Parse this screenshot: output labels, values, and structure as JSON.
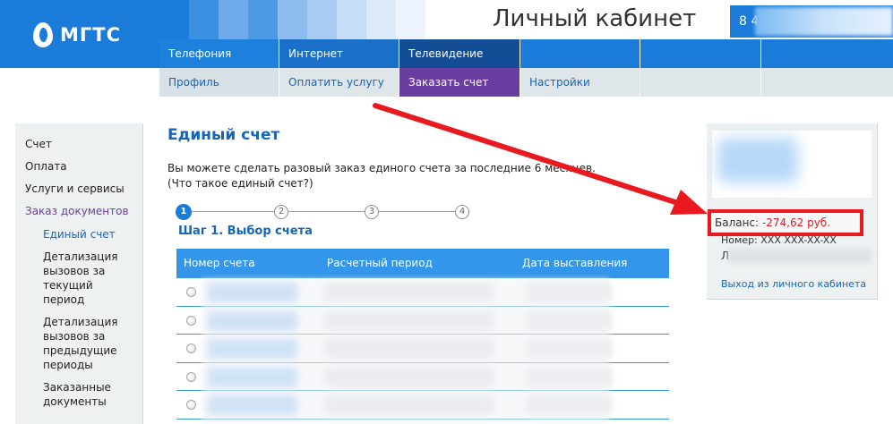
{
  "brand": {
    "logo_text": "МГТС",
    "cabinet_title": "Личный кабинет",
    "phone_prefix": "8 4"
  },
  "main_nav": {
    "items": [
      "Телефония",
      "Интернет",
      "Телевидение"
    ]
  },
  "sub_nav": {
    "items": [
      "Профиль",
      "Оплатить услугу",
      "Заказать счет",
      "Настройки"
    ],
    "active": "Заказать счет"
  },
  "sidebar": {
    "items": [
      "Счет",
      "Оплата",
      "Услуги и сервисы",
      "Заказ документов"
    ],
    "active_item": "Заказ документов",
    "sub_items": [
      "Единый счет",
      "Детализация вызовов за текущий период",
      "Детализация вызовов за предыдущие периоды",
      "Заказанные документы"
    ],
    "active_sub": "Единый счет"
  },
  "main": {
    "title": "Единый счет",
    "intro_line1": "Вы можете сделать разовый заказ единого счета за последние 6 месяцев.",
    "intro_line2": "(Что такое единый счет?)",
    "steps": [
      "1",
      "2",
      "3",
      "4"
    ],
    "current_step": 1,
    "step_title": "Шаг 1. Выбор счета",
    "table": {
      "headers": [
        "Номер счета",
        "Расчетный период",
        "Дата выставления"
      ],
      "row_count": 5
    }
  },
  "right_panel": {
    "balance_label": "Баланс:",
    "balance_value": "-274,62 руб.",
    "number_label": "Номер:",
    "number_value": "XXX XXX-XX-XX",
    "ls_label": "Л",
    "logout_label": "Выход из личного кабинета"
  },
  "colors": {
    "brand_blue": "#1a7bd8",
    "active_purple": "#6a3ea1",
    "link_blue": "#1565b8",
    "annotation_red": "#e8191f",
    "table_header": "#3396ea"
  },
  "icons": {
    "logo": "mgts-egg-logo",
    "radio": "radio-button",
    "annotation": "red-arrow"
  }
}
